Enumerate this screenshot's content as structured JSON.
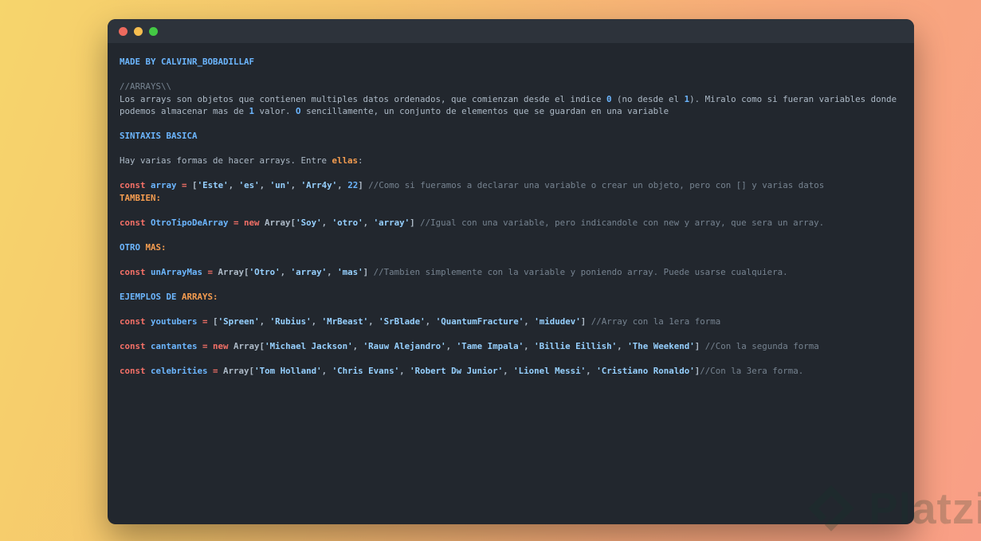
{
  "window": {
    "background": "#22272e",
    "titlebar_color": "#2d333b",
    "traffic_lights": [
      {
        "name": "close",
        "color": "#ed6a5e"
      },
      {
        "name": "minimize",
        "color": "#f5bd4f"
      },
      {
        "name": "maximize",
        "color": "#43c944"
      }
    ]
  },
  "colors": {
    "keyword": "#f47067",
    "variable": "#6cb6ff",
    "string": "#96d0ff",
    "number": "#6cb6ff",
    "comment": "#768390",
    "plain_text": "#adbac7",
    "heading_blue": "#6cb6ff",
    "label_orange": "#f69d50",
    "bg_gradient_start": "#f6d56c",
    "bg_gradient_end": "#f99e86"
  },
  "code": {
    "lines": [
      {
        "s": [
          [
            "h",
            "MADE BY CALVINR_BOBADILLAF"
          ]
        ]
      },
      {
        "s": []
      },
      {
        "s": [
          [
            "c",
            "//ARRAYS\\\\"
          ]
        ]
      },
      {
        "s": [
          [
            "t",
            "Los arrays son objetos que contienen multiples datos ordenados, que comienzan desde el indice "
          ],
          [
            "n",
            "0"
          ],
          [
            "t",
            " (no desde el "
          ],
          [
            "n",
            "1"
          ],
          [
            "t",
            "). Miralo como si fueran variables donde"
          ]
        ]
      },
      {
        "s": [
          [
            "t",
            "podemos almacenar mas de "
          ],
          [
            "n",
            "1"
          ],
          [
            "t",
            " valor. "
          ],
          [
            "n",
            "O"
          ],
          [
            "t",
            " sencillamente, un conjunto de elementos que se guardan en una variable"
          ]
        ]
      },
      {
        "s": []
      },
      {
        "s": [
          [
            "h",
            "SINTAXIS BASICA"
          ]
        ]
      },
      {
        "s": []
      },
      {
        "s": [
          [
            "t",
            "Hay varias formas de hacer arrays. Entre "
          ],
          [
            "o",
            "ellas"
          ],
          [
            "t",
            ":"
          ]
        ]
      },
      {
        "s": []
      },
      {
        "s": [
          [
            "k",
            "const "
          ],
          [
            "v",
            "array"
          ],
          [
            "k",
            " = "
          ],
          [
            "p",
            "["
          ],
          [
            "s",
            "'Este'"
          ],
          [
            "p",
            ", "
          ],
          [
            "s",
            "'es'"
          ],
          [
            "p",
            ", "
          ],
          [
            "s",
            "'un'"
          ],
          [
            "p",
            ", "
          ],
          [
            "s",
            "'Arr4y'"
          ],
          [
            "p",
            ", "
          ],
          [
            "n",
            "22"
          ],
          [
            "p",
            "] "
          ],
          [
            "c",
            "//Como si fueramos a declarar una variable o crear un objeto, pero con [] y varias datos"
          ]
        ]
      },
      {
        "s": [
          [
            "o",
            "TAMBIEN:"
          ]
        ]
      },
      {
        "s": []
      },
      {
        "s": [
          [
            "k",
            "const "
          ],
          [
            "v",
            "OtroTipoDeArray"
          ],
          [
            "k",
            " = new "
          ],
          [
            "p",
            "Array["
          ],
          [
            "s",
            "'Soy'"
          ],
          [
            "p",
            ", "
          ],
          [
            "s",
            "'otro'"
          ],
          [
            "p",
            ", "
          ],
          [
            "s",
            "'array'"
          ],
          [
            "p",
            "] "
          ],
          [
            "c",
            "//Igual con una variable, pero indicandole con new y array, que sera un array."
          ]
        ]
      },
      {
        "s": []
      },
      {
        "s": [
          [
            "h",
            "OTRO "
          ],
          [
            "o",
            "MAS:"
          ]
        ]
      },
      {
        "s": []
      },
      {
        "s": [
          [
            "k",
            "const "
          ],
          [
            "v",
            "unArrayMas"
          ],
          [
            "k",
            " = "
          ],
          [
            "p",
            "Array["
          ],
          [
            "s",
            "'Otro'"
          ],
          [
            "p",
            ", "
          ],
          [
            "s",
            "'array'"
          ],
          [
            "p",
            ", "
          ],
          [
            "s",
            "'mas'"
          ],
          [
            "p",
            "] "
          ],
          [
            "c",
            "//Tambien simplemente con la variable y poniendo array. Puede usarse cualquiera."
          ]
        ]
      },
      {
        "s": []
      },
      {
        "s": [
          [
            "h",
            "EJEMPLOS DE "
          ],
          [
            "o",
            "ARRAYS:"
          ]
        ]
      },
      {
        "s": []
      },
      {
        "s": [
          [
            "k",
            "const "
          ],
          [
            "v",
            "youtubers"
          ],
          [
            "k",
            " = "
          ],
          [
            "p",
            "["
          ],
          [
            "s",
            "'Spreen'"
          ],
          [
            "p",
            ", "
          ],
          [
            "s",
            "'Rubius'"
          ],
          [
            "p",
            ", "
          ],
          [
            "s",
            "'MrBeast'"
          ],
          [
            "p",
            ", "
          ],
          [
            "s",
            "'SrBlade'"
          ],
          [
            "p",
            ", "
          ],
          [
            "s",
            "'QuantumFracture'"
          ],
          [
            "p",
            ", "
          ],
          [
            "s",
            "'midudev'"
          ],
          [
            "p",
            "] "
          ],
          [
            "c",
            "//Array con la 1era forma"
          ]
        ]
      },
      {
        "s": []
      },
      {
        "s": [
          [
            "k",
            "const "
          ],
          [
            "v",
            "cantantes"
          ],
          [
            "k",
            " = new "
          ],
          [
            "p",
            "Array["
          ],
          [
            "s",
            "'Michael Jackson'"
          ],
          [
            "p",
            ", "
          ],
          [
            "s",
            "'Rauw Alejandro'"
          ],
          [
            "p",
            ", "
          ],
          [
            "s",
            "'Tame Impala'"
          ],
          [
            "p",
            ", "
          ],
          [
            "s",
            "'Billie Eillish'"
          ],
          [
            "p",
            ", "
          ],
          [
            "s",
            "'The Weekend'"
          ],
          [
            "p",
            "] "
          ],
          [
            "c",
            "//Con la segunda forma"
          ]
        ]
      },
      {
        "s": []
      },
      {
        "s": [
          [
            "k",
            "const "
          ],
          [
            "v",
            "celebrities"
          ],
          [
            "k",
            " = "
          ],
          [
            "p",
            "Array["
          ],
          [
            "s",
            "'Tom Holland'"
          ],
          [
            "p",
            ", "
          ],
          [
            "s",
            "'Chris Evans'"
          ],
          [
            "p",
            ", "
          ],
          [
            "s",
            "'Robert Dw Junior'"
          ],
          [
            "p",
            ", "
          ],
          [
            "s",
            "'Lionel Messi'"
          ],
          [
            "p",
            ", "
          ],
          [
            "s",
            "'Cristiano Ronaldo'"
          ],
          [
            "p",
            "]"
          ],
          [
            "c",
            "//Con la 3era forma."
          ]
        ]
      }
    ]
  },
  "watermark": {
    "brand": "Platzi"
  }
}
